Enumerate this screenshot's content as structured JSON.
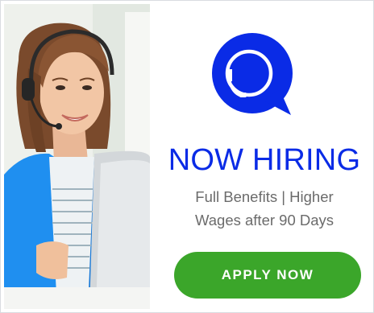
{
  "ad": {
    "headline": "NOW HIRING",
    "subline_1": "Full Benefits | Higher",
    "subline_2": "Wages after 90 Days",
    "cta_label": "APPLY NOW"
  },
  "colors": {
    "brand_blue": "#0a2be6",
    "cta_green": "#3ba62a",
    "subtext_gray": "#6b6b6b"
  },
  "icons": {
    "logo": "headset-chat-bubble-icon"
  }
}
